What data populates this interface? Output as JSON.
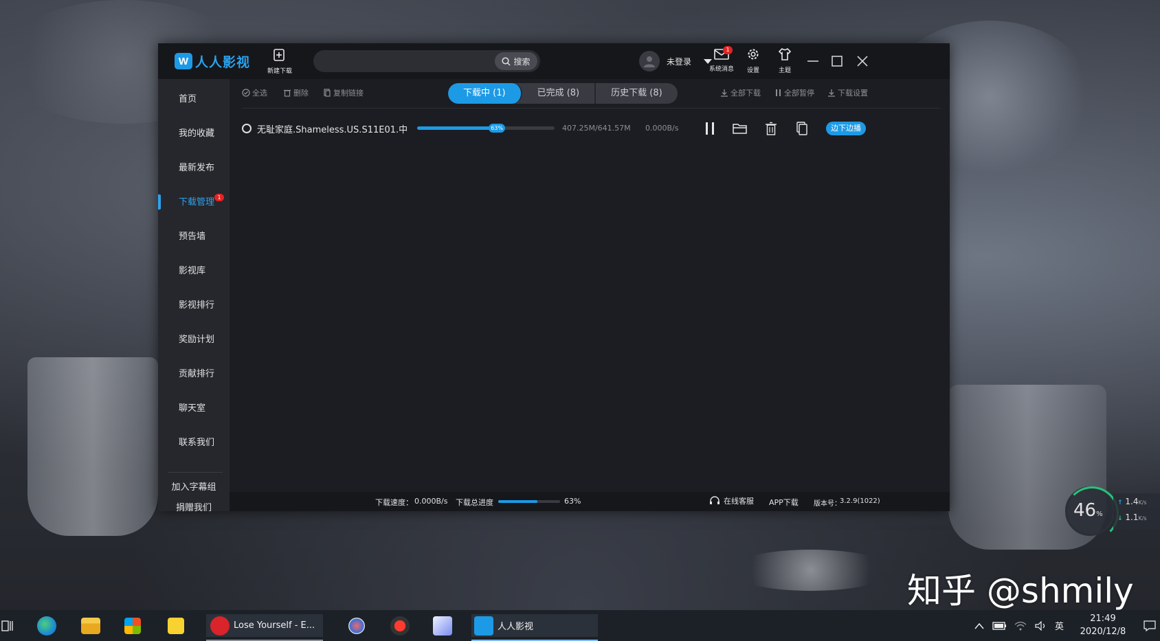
{
  "app": {
    "logo_text": "人人影视",
    "logo_mark": "W",
    "new_download_label": "新建下载",
    "search": {
      "placeholder": "",
      "button_label": "搜索"
    },
    "user": {
      "status": "未登录"
    },
    "toolbar_icons": {
      "messages_label": "系统消息",
      "messages_badge": "1",
      "settings_label": "设置",
      "theme_label": "主题"
    }
  },
  "sidebar": {
    "items": [
      {
        "label": "首页"
      },
      {
        "label": "我的收藏"
      },
      {
        "label": "最新发布"
      },
      {
        "label": "下载管理",
        "badge": "1",
        "active": true
      },
      {
        "label": "预告墙"
      },
      {
        "label": "影视库"
      },
      {
        "label": "影视排行"
      },
      {
        "label": "奖励计划"
      },
      {
        "label": "贡献排行"
      },
      {
        "label": "聊天室"
      },
      {
        "label": "联系我们"
      }
    ],
    "footer": {
      "join_label": "加入字幕组",
      "donate_label": "捐赠我们"
    }
  },
  "toolbar": {
    "select_all": "全选",
    "delete": "删除",
    "copy_link": "复制链接",
    "tabs": [
      {
        "label": "下载中 (1)",
        "active": true
      },
      {
        "label": "已完成 (8)"
      },
      {
        "label": "历史下载 (8)"
      }
    ],
    "download_all": "全部下载",
    "pause_all": "全部暂停",
    "download_settings": "下载设置"
  },
  "downloads": [
    {
      "filename": "无耻家庭.Shameless.US.S11E01.中",
      "progress_percent": 63,
      "progress_label": "63%",
      "size": "407.25M/641.57M",
      "speed": "0.000B/s",
      "stream_label": "边下边播"
    }
  ],
  "statusbar": {
    "speed_label": "下载速度：",
    "speed_value": "0.000B/s",
    "total_progress_label": "下载总进度",
    "total_progress_percent": 63,
    "total_progress_value": "63%",
    "support_label": "在线客服",
    "app_download_label": "APP下载",
    "version_label": "版本号：",
    "version_value": "3.2.9(1022)"
  },
  "net_widget": {
    "percent": "46",
    "percent_unit": "%",
    "upload": "1.4",
    "download": "1.1",
    "unit": "K/s"
  },
  "watermark": "知乎 @shmily",
  "taskbar": {
    "apps": [
      {
        "label": "Lose Yourself - E..."
      },
      {
        "label": "人人影视"
      }
    ],
    "ime": "英",
    "time": "21:49",
    "date": "2020/12/8"
  },
  "colors": {
    "accent": "#1d9ae6",
    "badge": "#e52323",
    "window_bg": "#1c1d22",
    "sidebar_bg": "#26272d"
  }
}
